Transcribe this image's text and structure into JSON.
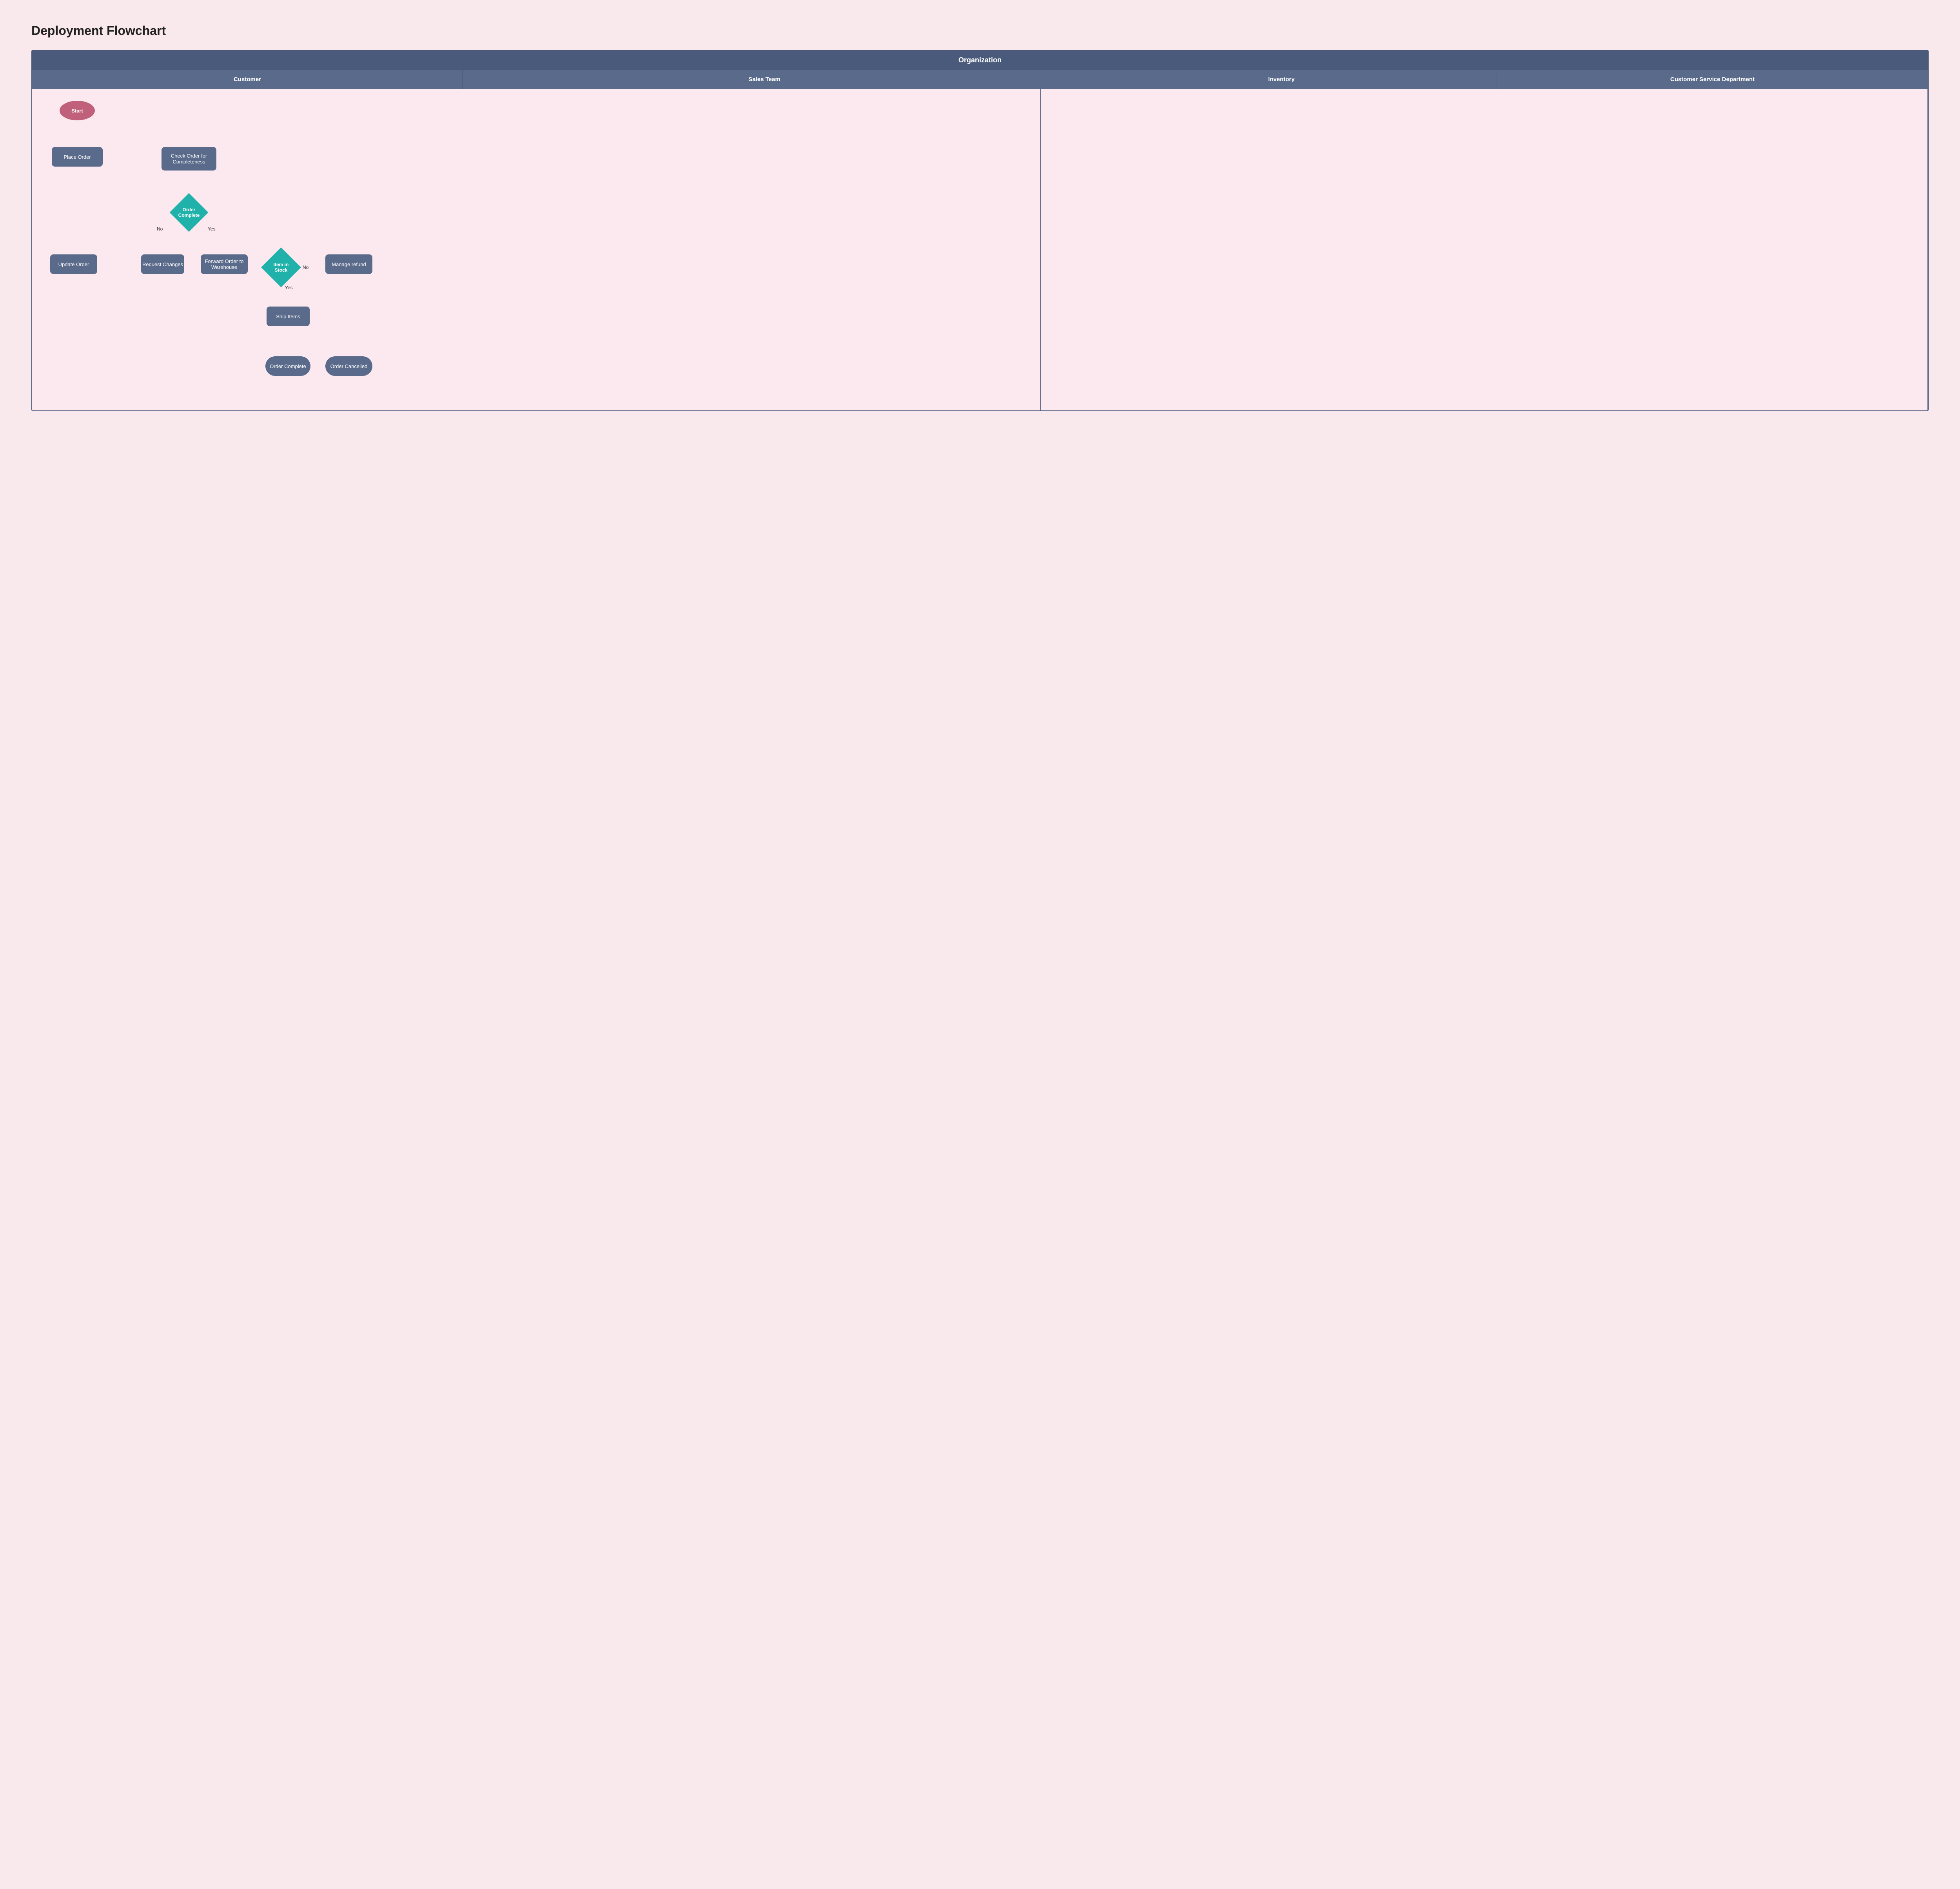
{
  "title": "Deployment Flowchart",
  "org_label": "Organization",
  "columns": [
    {
      "label": "Customer"
    },
    {
      "label": "Sales Team"
    },
    {
      "label": "Inventory"
    },
    {
      "label": "Customer Service Department"
    }
  ],
  "shapes": {
    "start": "Start",
    "place_order": "Place Order",
    "check_order": "Check Order for Completeness",
    "order_complete_diamond": "Order Complete",
    "no_label": "No",
    "yes_label": "Yes",
    "request_changes": "Request Changes",
    "forward_order": "Forward Order to Warehouse",
    "update_order": "Update Order",
    "item_in_stock": "Item in Stock",
    "no_label2": "No",
    "yes_label2": "Yes",
    "manage_refund": "Manage refund",
    "ship_items": "Ship Items",
    "order_complete_end": "Order Complete",
    "order_cancelled": "Order Cancelled"
  }
}
